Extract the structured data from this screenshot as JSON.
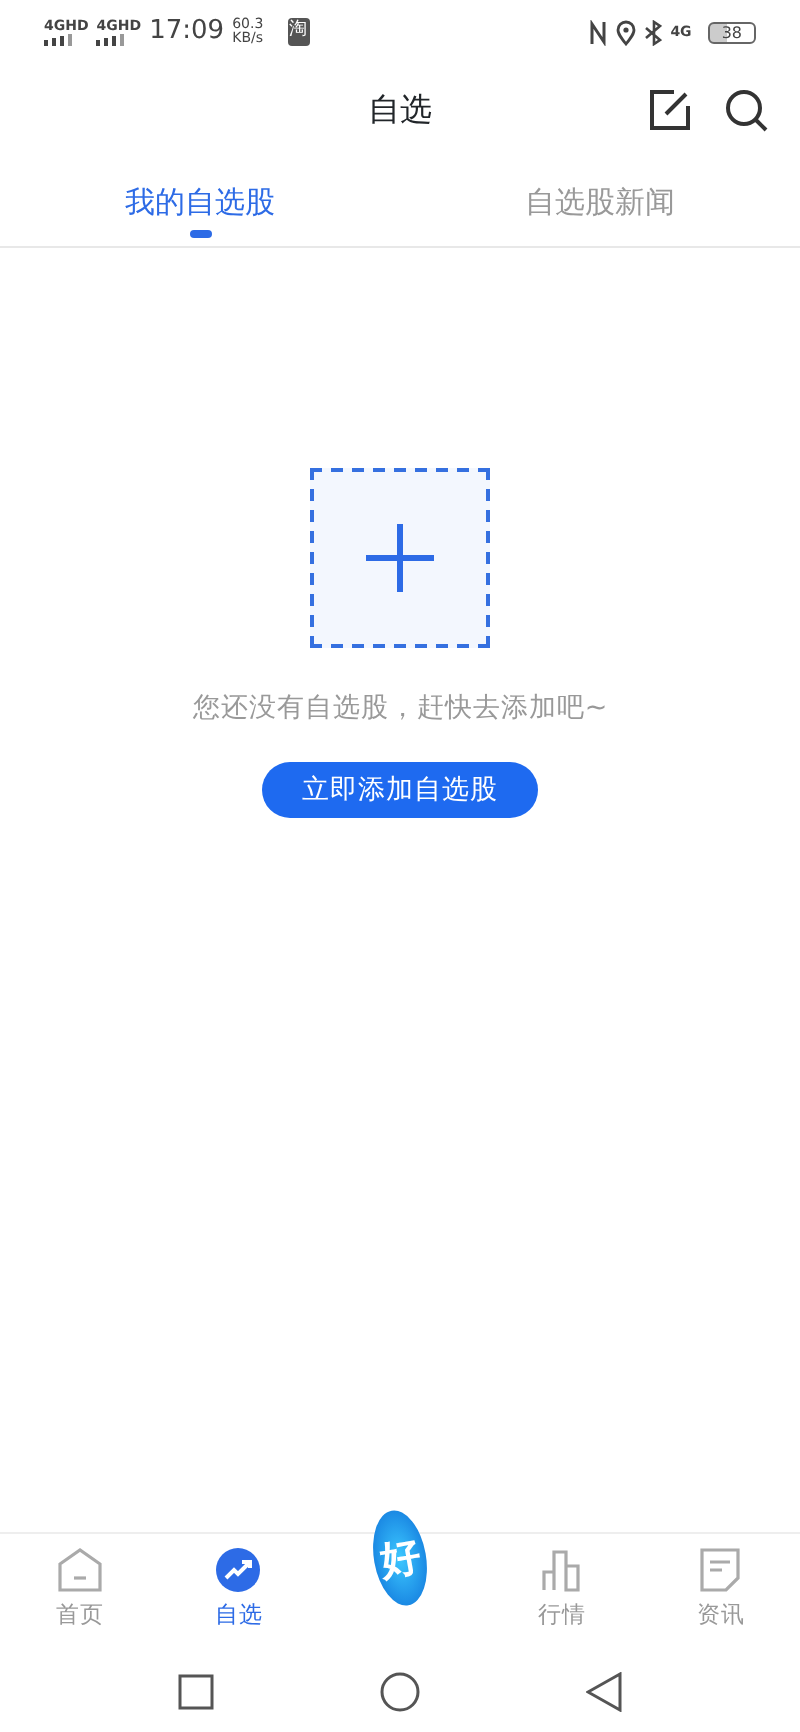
{
  "status_bar": {
    "networks": [
      "4GHD",
      "4GHD"
    ],
    "time": "17:09",
    "speed": "60.3",
    "speed_unit": "KB/s",
    "app_badge": "淘",
    "network_right": "4G",
    "battery": "38"
  },
  "header": {
    "title": "自选"
  },
  "tabs": [
    {
      "label": "我的自选股",
      "selected": true
    },
    {
      "label": "自选股新闻",
      "selected": false
    }
  ],
  "empty_state": {
    "message": "您还没有自选股，赶快去添加吧~",
    "button": "立即添加自选股"
  },
  "bottom_nav": [
    {
      "label": "首页",
      "kind": "home",
      "selected": false
    },
    {
      "label": "自选",
      "kind": "watchlist",
      "selected": true
    },
    {
      "label": "好",
      "kind": "center",
      "selected": false
    },
    {
      "label": "行情",
      "kind": "market",
      "selected": false
    },
    {
      "label": "资讯",
      "kind": "news",
      "selected": false
    }
  ]
}
